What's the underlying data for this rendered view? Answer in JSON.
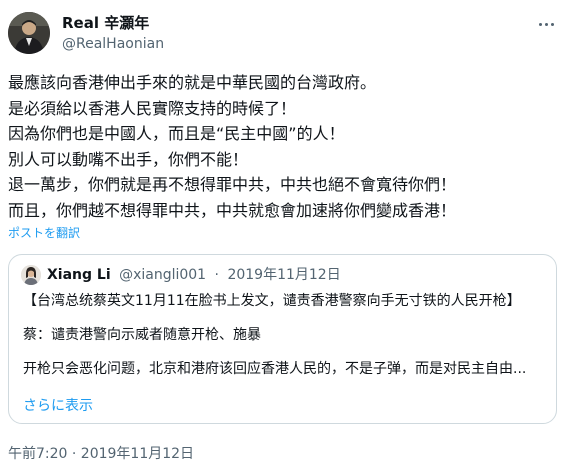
{
  "author": {
    "name": "Real 辛灝年",
    "handle": "@RealHaonian",
    "avatar_icon": "profile-photo"
  },
  "tweet": {
    "lines": [
      "最應該向香港伸出手來的就是中華民國的台灣政府。",
      "是必須給以香港人民實際支持的時候了！",
      "因為你們也是中國人，而且是“民主中國”的人！",
      "別人可以動嘴不出手，你們不能！",
      "退一萬步，你們就是再不想得罪中共，中共也絕不會寬待你們！",
      "而且，你們越不想得罪中共，中共就愈會加速將你們變成香港！"
    ],
    "translate_label": "ポストを翻訳",
    "timestamp": "午前7:20 · 2019年11月12日"
  },
  "quote": {
    "name": "Xiang Li",
    "handle": "@xiangli001",
    "separator": "·",
    "date": "2019年11月12日",
    "lines": [
      "【台湾总统蔡英文11月11在脸书上发文，谴责香港警察向手无寸铁的人民开枪】",
      "蔡：谴责港警向示威者随意开枪、施暴",
      "开枪只会恶化问题，北京和港府该回应香港人民的，不是子弹，而是对民主自由..."
    ],
    "show_more_label": "さらに表示"
  },
  "colors": {
    "text": "#0f1419",
    "secondary": "#536471",
    "link": "#1d9bf0",
    "border": "#cfd9de"
  }
}
